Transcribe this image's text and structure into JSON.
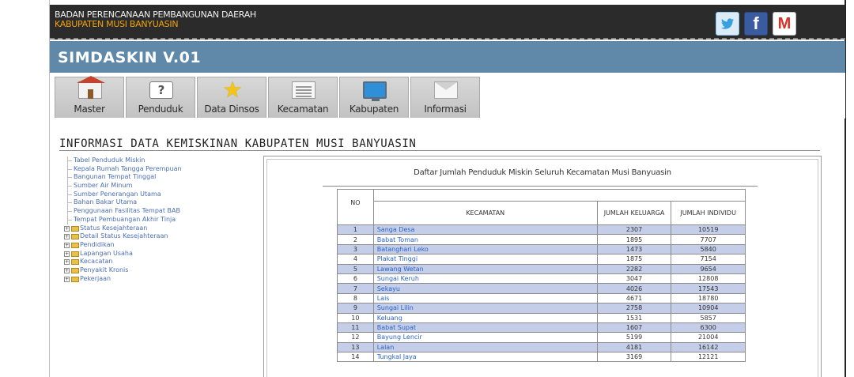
{
  "header": {
    "org_line1": "BADAN PERENCANAAN PEMBANGUNAN DAERAH",
    "org_line2": "KABUPATEN MUSI BANYUASIN",
    "social_icons": [
      "twitter-icon",
      "facebook-icon",
      "gmail-icon"
    ],
    "facebook_glyph": "f",
    "gmail_glyph": "M"
  },
  "banner": {
    "app_name": "SIMDASKIN V.01"
  },
  "nav": {
    "tabs": [
      {
        "label": "Master",
        "icon": "house-icon"
      },
      {
        "label": "Penduduk",
        "icon": "question-icon"
      },
      {
        "label": "Data Dinsos",
        "icon": "star-icon"
      },
      {
        "label": "Kecamatan",
        "icon": "document-icon"
      },
      {
        "label": "Kabupaten",
        "icon": "monitor-icon"
      },
      {
        "label": "Informasi",
        "icon": "envelope-icon"
      }
    ]
  },
  "page": {
    "title": "INFORMASI DATA KEMISKINAN KABUPATEN MUSI BANYUASIN"
  },
  "tree": {
    "links": [
      "Tabel Penduduk Miskin",
      "Kepala Rumah Tangga Perempuan",
      "Bangunan Tempat Tinggal",
      "Sumber Air Minum",
      "Sumber Penerangan Utama",
      "Bahan Bakar Utama",
      "Penggunaan Fasilitas Tempat BAB",
      "Tempat Pembuangan Akhir Tinja"
    ],
    "folders": [
      "Status Kesejahteraan",
      "Detail Status Kesejahteraan",
      "Pendidikan",
      "Lapangan Usaha",
      "Kecacatan",
      "Penyakit Kronis",
      "Pekerjaan"
    ]
  },
  "table": {
    "caption": "Daftar Jumlah Penduduk Miskin Seluruh Kecamatan Musi Banyuasin",
    "headers": {
      "no": "NO",
      "kecamatan": "KECAMATAN",
      "keluarga": "JUMLAH KELUARGA",
      "individu": "JUMLAH INDIVIDU"
    },
    "rows": [
      {
        "no": "1",
        "kecamatan": "Sanga Desa",
        "keluarga": "2307",
        "individu": "10519"
      },
      {
        "no": "2",
        "kecamatan": "Babat Toman",
        "keluarga": "1895",
        "individu": "7707"
      },
      {
        "no": "3",
        "kecamatan": "Batanghari Leko",
        "keluarga": "1473",
        "individu": "5840"
      },
      {
        "no": "4",
        "kecamatan": "Plakat Tinggi",
        "keluarga": "1875",
        "individu": "7154"
      },
      {
        "no": "5",
        "kecamatan": "Lawang Wetan",
        "keluarga": "2282",
        "individu": "9654"
      },
      {
        "no": "6",
        "kecamatan": "Sungai Keruh",
        "keluarga": "3047",
        "individu": "12808"
      },
      {
        "no": "7",
        "kecamatan": "Sekayu",
        "keluarga": "4026",
        "individu": "17543"
      },
      {
        "no": "8",
        "kecamatan": "Lais",
        "keluarga": "4671",
        "individu": "18780"
      },
      {
        "no": "9",
        "kecamatan": "Sungai Lilin",
        "keluarga": "2758",
        "individu": "10904"
      },
      {
        "no": "10",
        "kecamatan": "Keluang",
        "keluarga": "1531",
        "individu": "5857"
      },
      {
        "no": "11",
        "kecamatan": "Babat Supat",
        "keluarga": "1607",
        "individu": "6300"
      },
      {
        "no": "12",
        "kecamatan": "Bayung Lencir",
        "keluarga": "5199",
        "individu": "21004"
      },
      {
        "no": "13",
        "kecamatan": "Lalan",
        "keluarga": "4181",
        "individu": "16142"
      },
      {
        "no": "14",
        "kecamatan": "Tungkal Jaya",
        "keluarga": "3169",
        "individu": "12121"
      }
    ]
  },
  "colors": {
    "topbar": "#2b2b2b",
    "org_line2": "#f0a20a",
    "banner": "#5f88a9",
    "row_highlight": "#c4cee8",
    "link": "#4b6fb5"
  }
}
